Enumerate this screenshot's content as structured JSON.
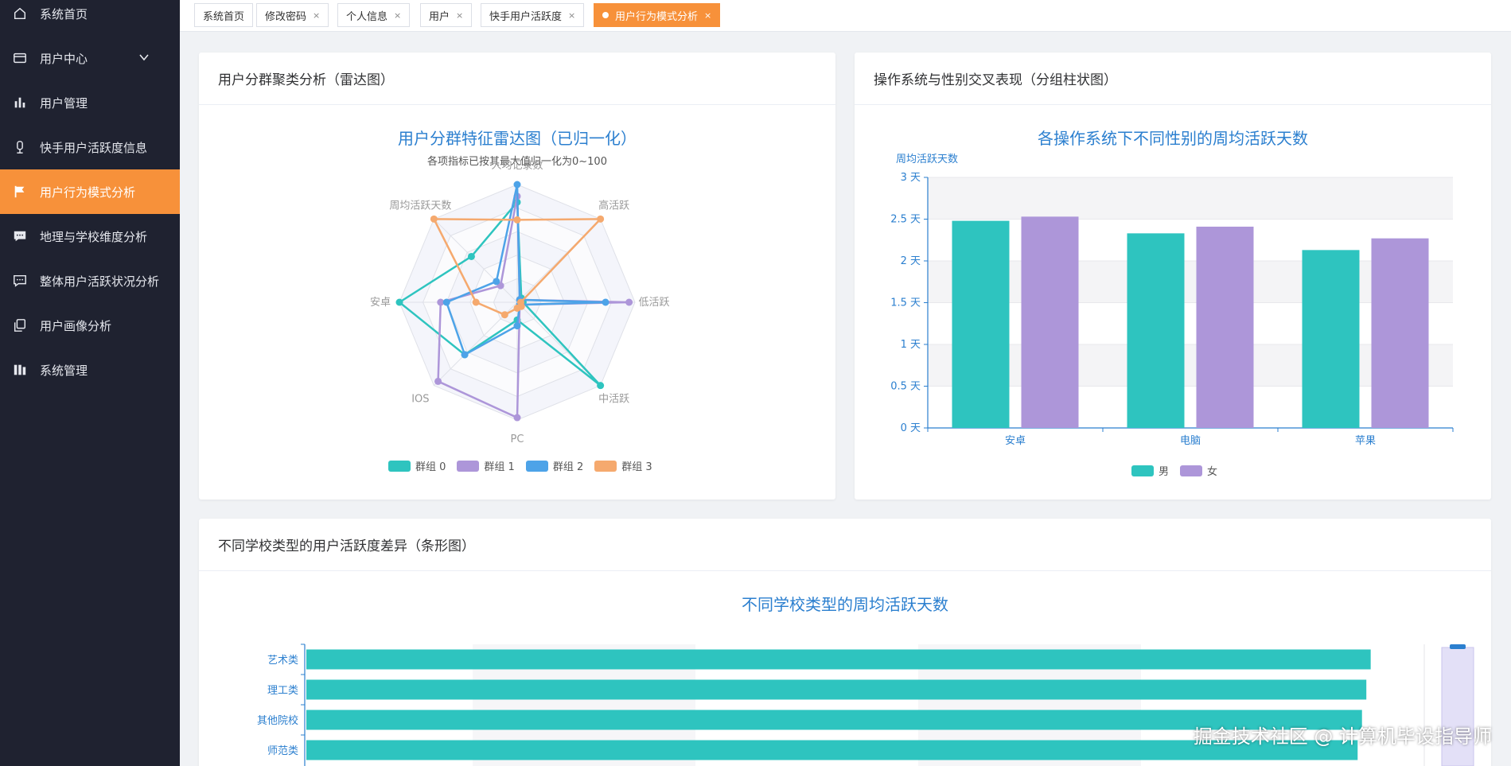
{
  "sidebar": {
    "items": [
      {
        "label": "系统首页",
        "icon": "home-icon"
      },
      {
        "label": "用户中心",
        "icon": "wallet-icon"
      },
      {
        "label": "用户管理",
        "icon": "bar-chart-icon"
      },
      {
        "label": "快手用户活跃度信息",
        "icon": "microphone-icon"
      },
      {
        "label": "用户行为模式分析",
        "icon": "flag-icon"
      },
      {
        "label": "地理与学校维度分析",
        "icon": "chat-icon"
      },
      {
        "label": "整体用户活跃状况分析",
        "icon": "chat-dots-icon"
      },
      {
        "label": "用户画像分析",
        "icon": "copy-icon"
      },
      {
        "label": "系统管理",
        "icon": "columns-icon"
      }
    ]
  },
  "tabs": [
    {
      "label": "系统首页",
      "closable": false
    },
    {
      "label": "修改密码",
      "closable": true
    },
    {
      "label": "个人信息",
      "closable": true
    },
    {
      "label": "用户",
      "closable": true
    },
    {
      "label": "快手用户活跃度",
      "closable": true
    },
    {
      "label": "用户行为模式分析",
      "closable": true,
      "active": true
    }
  ],
  "tab_close_glyph": "×",
  "colors": {
    "accent": "#f7913a",
    "sidebar_bg": "#1f2230",
    "teal": "#2ec4bf",
    "purple": "#ad96d9",
    "blue": "#4da3e8",
    "orange": "#f5a96e",
    "title_blue": "#2b7fcf"
  },
  "cards": {
    "radar": {
      "header": "用户分群聚类分析（雷达图）"
    },
    "grouped_bar": {
      "header": "操作系统与性别交叉表现（分组柱状图）"
    },
    "hbar": {
      "header": "不同学校类型的用户活跃度差异（条形图）"
    }
  },
  "chart_data": [
    {
      "type": "radar",
      "title": "用户分群特征雷达图（已归一化）",
      "subtitle": "各项指标已按其最大值归一化为0~100",
      "indicators": [
        "人均记录数",
        "高活跃",
        "低活跃",
        "中活跃",
        "PC",
        "IOS",
        "安卓",
        "周均活跃天数"
      ],
      "max": 100,
      "series": [
        {
          "name": "群组 0",
          "color": "#2ec4bf",
          "values": [
            85,
            5,
            5,
            100,
            15,
            63,
            100,
            55
          ]
        },
        {
          "name": "群组 1",
          "color": "#ad96d9",
          "values": [
            90,
            3,
            95,
            3,
            98,
            95,
            65,
            20
          ]
        },
        {
          "name": "群组 2",
          "color": "#4da3e8",
          "values": [
            100,
            3,
            75,
            3,
            20,
            63,
            60,
            25
          ]
        },
        {
          "name": "群组 3",
          "color": "#f5a96e",
          "values": [
            70,
            100,
            3,
            5,
            5,
            15,
            35,
            100
          ]
        }
      ]
    },
    {
      "type": "bar",
      "title": "各操作系统下不同性别的周均活跃天数",
      "ylabel": "周均活跃天数",
      "unit": "天",
      "categories": [
        "安卓",
        "电脑",
        "苹果"
      ],
      "y_ticks": [
        "0 天",
        "0.5 天",
        "1 天",
        "1.5 天",
        "2 天",
        "2.5 天",
        "3 天"
      ],
      "ylim": [
        0,
        3
      ],
      "series": [
        {
          "name": "男",
          "color": "#2ec4bf",
          "values": [
            2.48,
            2.33,
            2.13
          ]
        },
        {
          "name": "女",
          "color": "#ad96d9",
          "values": [
            2.53,
            2.41,
            2.27
          ]
        }
      ]
    },
    {
      "type": "bar",
      "orientation": "horizontal",
      "title": "不同学校类型的周均活跃天数",
      "categories": [
        "艺术类",
        "理工类",
        "其他院校",
        "师范类"
      ],
      "values": [
        2.45,
        2.44,
        2.43,
        2.42
      ],
      "xlim": [
        0,
        2.5
      ],
      "color": "#2ec4bf"
    }
  ],
  "watermark": "掘金技术社区 @ 计算机毕设指导师"
}
